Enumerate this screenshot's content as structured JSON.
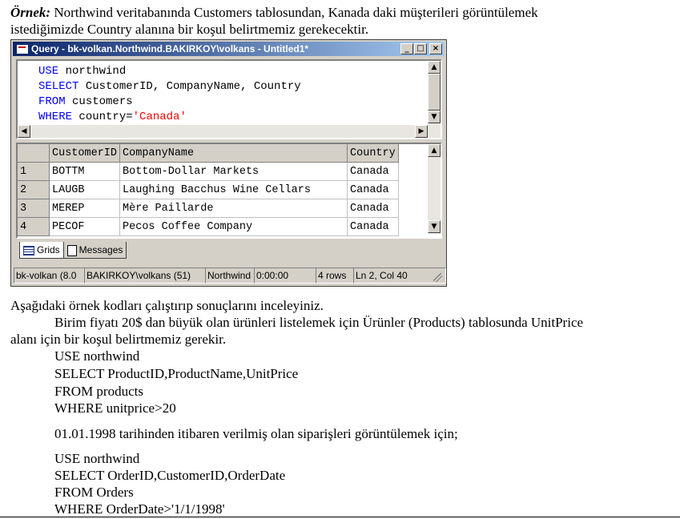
{
  "intro": {
    "label": "Örnek:",
    "line1": " Northwind veritabanında Customers tablosundan, Kanada daki müşterileri görüntülemek",
    "line2": "istediğimizde Country alanına bir koşul belirtmemiz gerekecektir."
  },
  "window": {
    "title": "Query - bk-volkan.Northwind.BAKIRKOY\\volkans - Untitled1*",
    "buttons": [
      "_",
      "□",
      "×"
    ],
    "code": {
      "line1_kw": "USE",
      "line1_rest": " northwind",
      "line2_kw": "SELECT",
      "line2_rest": " CustomerID, CompanyName, Country",
      "line3_kw": "FROM",
      "line3_rest": " customers",
      "line4_kw": "WHERE",
      "line4_rest": " country=",
      "line4_str": "'Canada'"
    },
    "results": {
      "columns": [
        "CustomerID",
        "CompanyName",
        "Country"
      ],
      "rows": [
        {
          "n": "1",
          "id": "BOTTM",
          "name": "Bottom-Dollar Markets",
          "country": "Canada"
        },
        {
          "n": "2",
          "id": "LAUGB",
          "name": "Laughing Bacchus Wine Cellars",
          "country": "Canada"
        },
        {
          "n": "3",
          "id": "MEREP",
          "name": "Mère Paillarde",
          "country": "Canada"
        },
        {
          "n": "4",
          "id": "PECOF",
          "name": "Pecos Coffee Company",
          "country": "Canada"
        }
      ]
    },
    "tabs": [
      "Grids",
      "Messages"
    ],
    "status": [
      "bk-volkan (8.0",
      "BAKIRKOY\\volkans (51)",
      "Northwind",
      "0:00:00",
      "4 rows",
      "Ln 2, Col 40"
    ]
  },
  "body": {
    "p1": "Aşağıdaki örnek kodları çalıştırıp sonuçlarını inceleyiniz.",
    "p2a": "Birim fiyatı 20$ dan büyük olan ürünleri listelemek için Ürünler (Products) tablosunda UnitPrice",
    "p2b": "alanı için bir koşul belirtmemiz gerekir.",
    "code1": [
      "USE northwind",
      "SELECT ProductID,ProductName,UnitPrice",
      "FROM products",
      "WHERE unitprice>20"
    ],
    "p3": "01.01.1998 tarihinden itibaren verilmiş olan siparişleri görüntülemek için;",
    "code2": [
      "USE northwind",
      "SELECT OrderID,CustomerID,OrderDate",
      "FROM Orders",
      "WHERE OrderDate>'1/1/1998'"
    ]
  }
}
